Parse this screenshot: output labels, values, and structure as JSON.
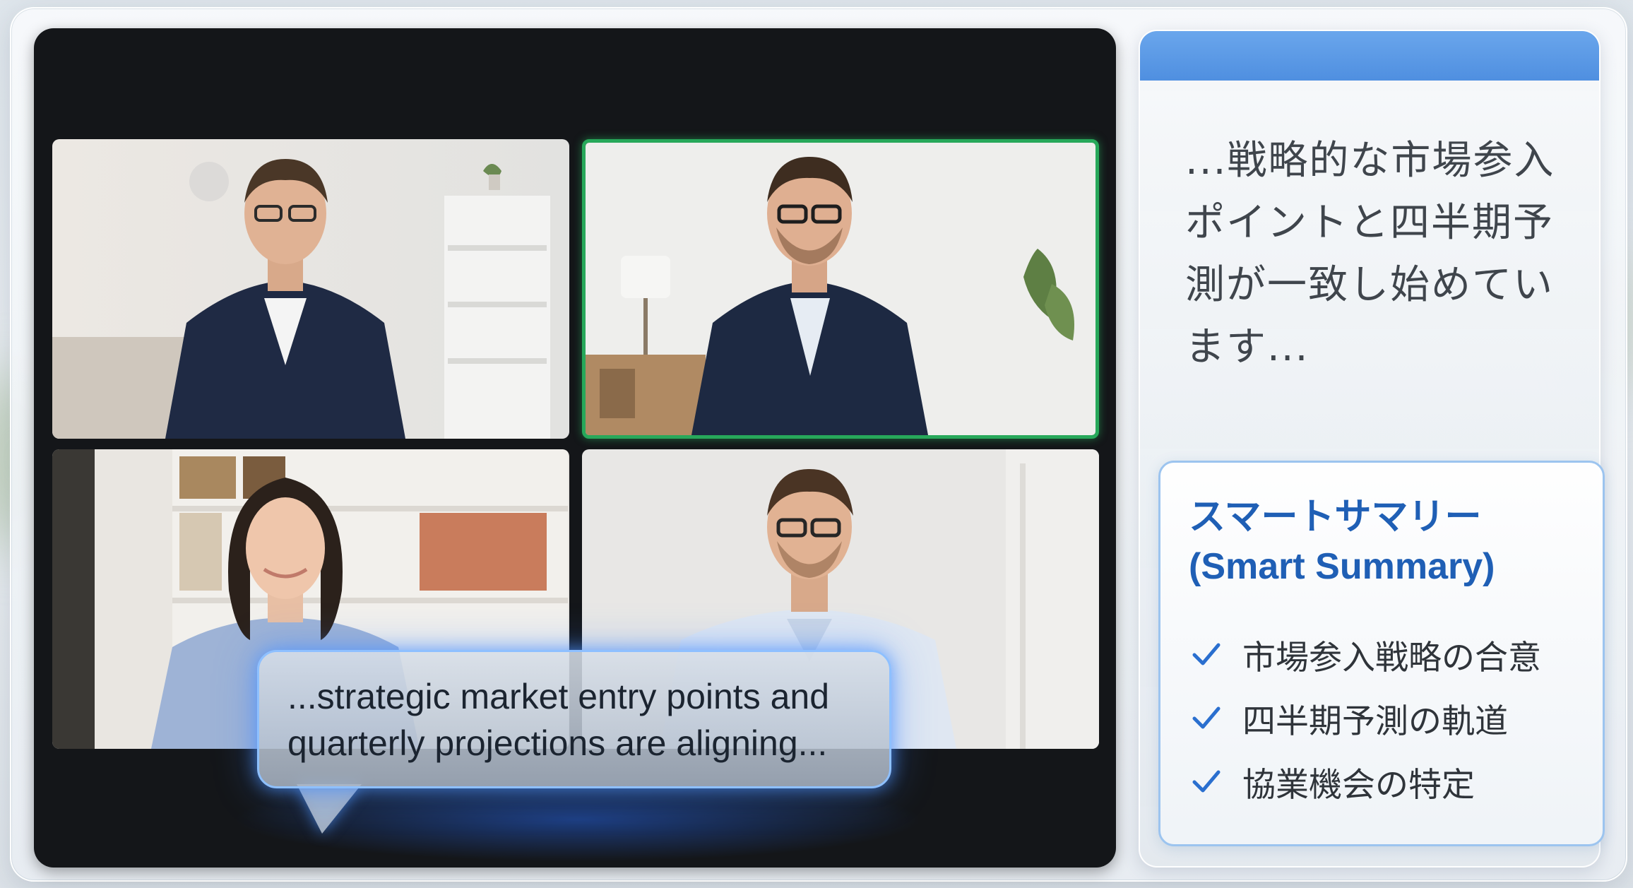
{
  "meeting": {
    "participants": [
      {
        "id": "p1",
        "speaking": false
      },
      {
        "id": "p2",
        "speaking": true
      },
      {
        "id": "p3",
        "speaking": false
      },
      {
        "id": "p4",
        "speaking": false
      }
    ],
    "live_caption": {
      "line1": "...strategic market entry points and",
      "line2": "quarterly projections are aligning..."
    }
  },
  "transcript": {
    "lines": [
      "...戦略的な市場参入",
      "ポイントと四半期予",
      "測が一致し始めてい",
      "ます..."
    ]
  },
  "smart_summary": {
    "title_line1": "スマートサマリー",
    "title_line2": "(Smart Summary)",
    "items": [
      {
        "label": "市場参入戦略の合意",
        "icon": "check-icon"
      },
      {
        "label": "四半期予測の軌道",
        "icon": "check-icon"
      },
      {
        "label": "協業機会の特定",
        "icon": "check-icon"
      }
    ]
  },
  "colors": {
    "accent": "#1f5fb5",
    "speaking_border": "#27a85a",
    "caption_glow": "#8ec0ff",
    "header": "#5b99e6"
  }
}
